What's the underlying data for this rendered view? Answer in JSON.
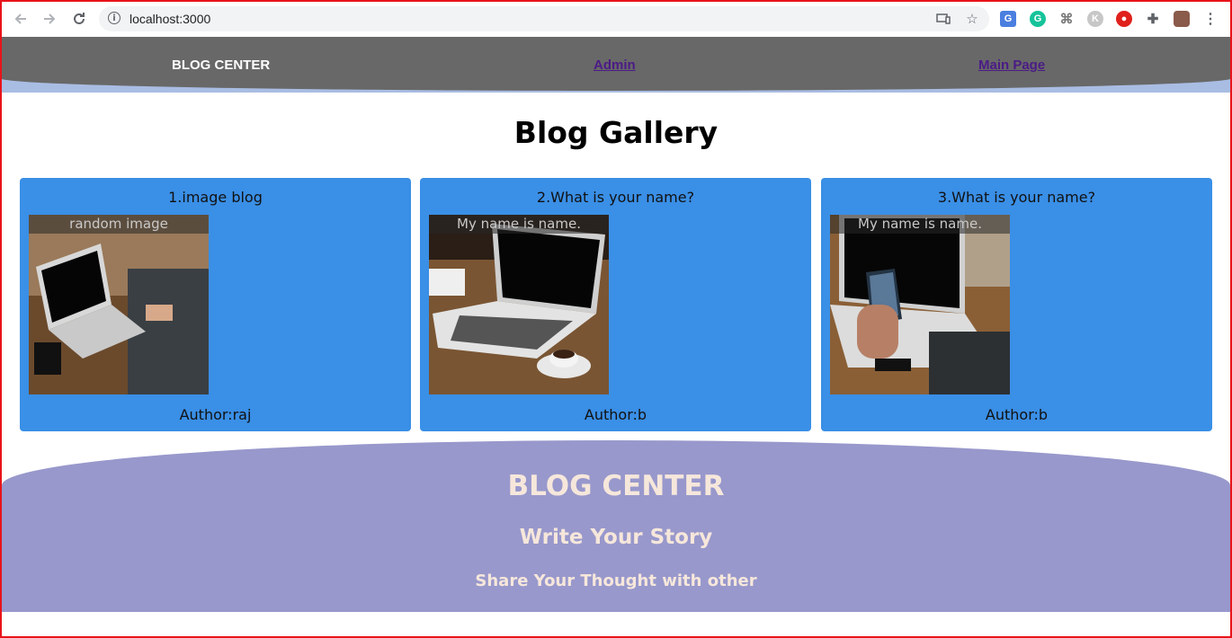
{
  "browser": {
    "url": "localhost:3000",
    "extensions": [
      "translate-icon",
      "grammarly-icon",
      "tag-icon",
      "k-icon",
      "shield-icon",
      "puzzle-icon",
      "profile-avatar"
    ]
  },
  "nav": {
    "brand": "BLOG CENTER",
    "links": [
      {
        "label": "Admin"
      },
      {
        "label": "Main Page"
      }
    ]
  },
  "page": {
    "title": "Blog Gallery"
  },
  "cards": [
    {
      "title": "1.image blog",
      "caption": "random image",
      "author": "Author:raj"
    },
    {
      "title": "2.What is your name?",
      "caption": "My name is name.",
      "author": "Author:b"
    },
    {
      "title": "3.What is your name?",
      "caption": "My name is name.",
      "author": "Author:b"
    }
  ],
  "footer": {
    "brand": "BLOG CENTER",
    "tagline": "Write Your Story",
    "subline": "Share Your Thought with other"
  },
  "colors": {
    "nav_bg": "#686868",
    "card_bg": "#3a8fe6",
    "footer_bg": "#9898cc",
    "footer_text": "#f6e7db",
    "frame_border": "#e8131a"
  }
}
